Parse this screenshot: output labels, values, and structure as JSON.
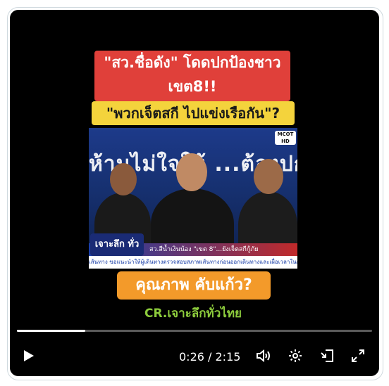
{
  "video": {
    "caption_top": "\"สว.ชื่อดัง\" โดดปกป้องชาว เขต8!!",
    "caption_question": "\"พวกเจ็ตสกี ไปแข่งเรือกัน\"?",
    "scene_banner": "ห้ามไม่ใจให้ ...ต้องปก",
    "scene_corner_logo": "MCOT HD",
    "show_logo": "เจาะลึก ทั่วไทย",
    "lower_third": "สว.สีน้ำเงินน้อง \"เขต 8\"...ยังเจ็ตสกีกู้ภัย",
    "ticker": "เส้นทาง ขอแนะนำให้ผู้เดินทางตรวจสอบสภาพเส้นทางก่อนออกเดินทางและเผื่อเวลาในการ",
    "caption_quality": "คุณภาพ คับแก้ว?",
    "credit": "CR.เจาะลึกทั่วไทย"
  },
  "player": {
    "progress": 0.193,
    "time_display": "0:26 / 2:15",
    "icons": [
      "play-icon",
      "volume-icon",
      "settings-icon",
      "pip-icon",
      "fullscreen-icon"
    ]
  },
  "colors": {
    "caption_red": "#e0403a",
    "caption_yellow": "#f4d33c",
    "caption_orange": "#f39a2a",
    "credit_green": "#8ccb3c"
  }
}
